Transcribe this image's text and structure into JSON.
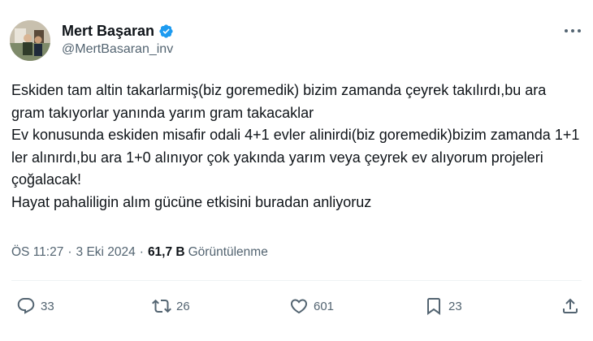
{
  "author": {
    "display_name": "Mert Başaran",
    "handle": "@MertBasaran_inv"
  },
  "tweet": {
    "text": "Eskiden tam altin takarlarmiş(biz goremedik) bizim zamanda çeyrek takılırdı,bu ara gram takıyorlar yanında yarım gram takacaklar\nEv konusunda eskiden misafir odali 4+1 evler alinirdi(biz goremedik)bizim zamanda 1+1 ler alınırdı,bu ara 1+0 alınıyor çok yakında yarım veya çeyrek ev alıyorum projeleri çoğalacak!\nHayat pahaliligin alım gücüne etkisini buradan anliyoruz",
    "time": "ÖS 11:27",
    "date": "3 Eki 2024",
    "separator": "·",
    "views_count": "61,7 B",
    "views_label": "Görüntülenme"
  },
  "actions": {
    "replies": "33",
    "reposts": "26",
    "likes": "601",
    "bookmarks": "23"
  },
  "colors": {
    "text": "#0f1419",
    "secondary": "#536471",
    "verified": "#1d9bf0",
    "divider": "#eff3f4"
  },
  "icons": [
    "verified-badge-icon",
    "more-icon",
    "reply-icon",
    "repost-icon",
    "like-icon",
    "bookmark-icon",
    "share-icon"
  ]
}
